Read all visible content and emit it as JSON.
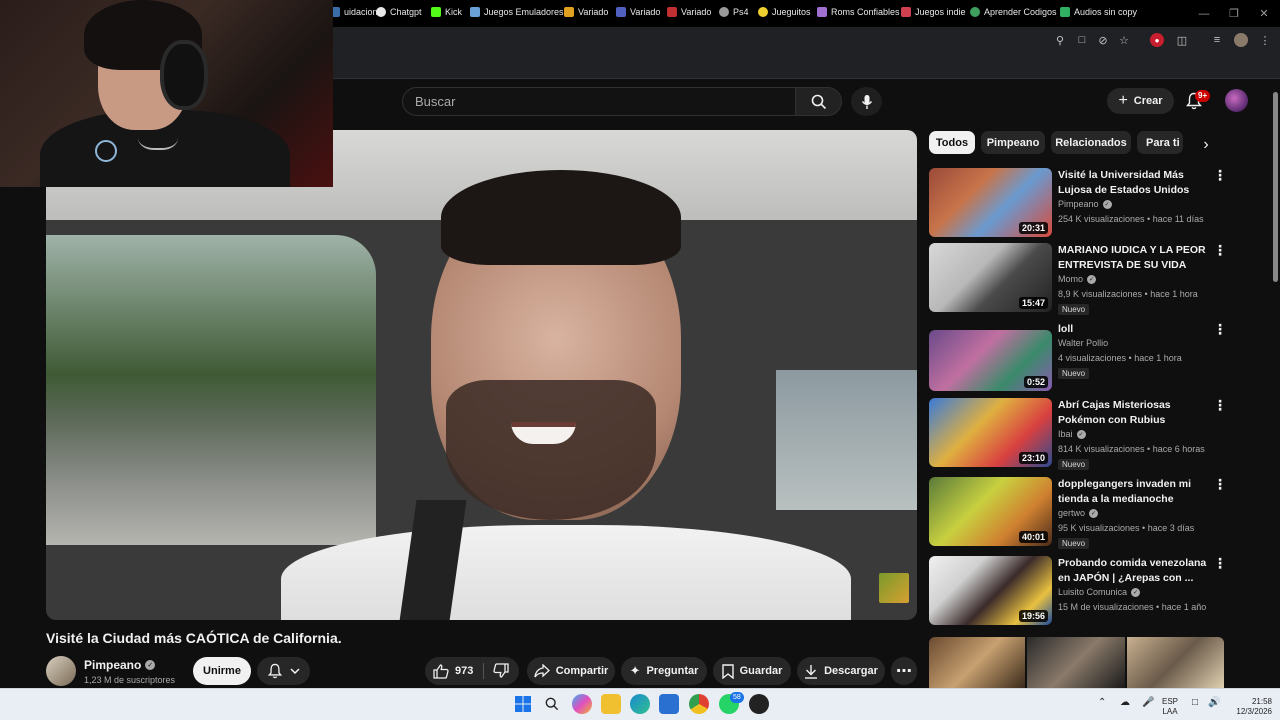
{
  "browser": {
    "window_controls": [
      "—",
      "❐",
      "✕"
    ],
    "bookmarks": [
      {
        "label": "uidacion",
        "color": "#3b6ea8"
      },
      {
        "label": "Chatgpt",
        "color": "#e8e8e8"
      },
      {
        "label": "Kick",
        "color": "#53fc18"
      },
      {
        "label": "Juegos Emuladores",
        "color": "#6aa0d8"
      },
      {
        "label": "Variado",
        "color": "#e0a020"
      },
      {
        "label": "Variado",
        "color": "#5060c0"
      },
      {
        "label": "Variado",
        "color": "#c03030"
      },
      {
        "label": "Ps4",
        "color": "#9a9a9a"
      },
      {
        "label": "Jueguitos",
        "color": "#f0d030"
      },
      {
        "label": "Roms Confiables",
        "color": "#a070d0"
      },
      {
        "label": "Juegos indie",
        "color": "#d04050"
      },
      {
        "label": "Aprender Codigos",
        "color": "#40a060"
      },
      {
        "label": "Audios sin copy",
        "color": "#30b060"
      }
    ]
  },
  "header": {
    "search_placeholder": "Buscar",
    "create_label": "Crear",
    "notification_count": "9+"
  },
  "video": {
    "title": "Visité la Ciudad más CAÓTICA de California.",
    "channel": "Pimpeano",
    "subscribers": "1,23 M de suscriptores",
    "join_label": "Unirme",
    "likes": "973",
    "share_label": "Compartir",
    "ask_label": "Preguntar",
    "save_label": "Guardar",
    "download_label": "Descargar"
  },
  "sidebar": {
    "chips": [
      "Todos",
      "Pimpeano",
      "Relacionados",
      "Para ti"
    ],
    "active_chip": "Todos",
    "recommendations": [
      {
        "title_line1": "Visité la Universidad Más",
        "title_line2": "Lujosa de Estados Unidos",
        "channel": "Pimpeano",
        "verified": true,
        "meta": "254 K visualizaciones • hace 11 días",
        "badge": "",
        "duration": "20:31",
        "thumb": "linear-gradient(135deg,#9a4a3a 0%,#c8744a 35%,#6a9ad0 60%,#d84a3a 100%)"
      },
      {
        "title_line1": "MARIANO IUDICA Y LA PEOR",
        "title_line2": "ENTREVISTA DE SU VIDA",
        "channel": "Momo",
        "verified": true,
        "meta": "8,9 K visualizaciones • hace 1 hora",
        "badge": "Nuevo",
        "duration": "15:47",
        "thumb": "linear-gradient(135deg,#d8d8d8 0%,#b8b8b8 40%,#4a4a4a 60%,#222 100%)"
      },
      {
        "title_line1": "loll",
        "title_line2": "",
        "channel": "Walter Pollio",
        "verified": false,
        "meta": "4 visualizaciones • hace 1 hora",
        "badge": "Nuevo",
        "duration": "0:52",
        "thumb": "linear-gradient(135deg,#6a4a8a 0%,#c070a0 40%,#3a8a6a 70%,#8a5ab0 100%)"
      },
      {
        "title_line1": "Abrí Cajas Misteriosas",
        "title_line2": "Pokémon con Rubius",
        "channel": "Ibai",
        "verified": true,
        "meta": "814 K visualizaciones • hace 6 horas",
        "badge": "Nuevo",
        "duration": "23:10",
        "thumb": "linear-gradient(135deg,#3a7ad8 0%,#e0b040 40%,#d84040 70%,#2a4a90 100%)"
      },
      {
        "title_line1": "dopplegangers invaden mi",
        "title_line2": "tienda a la medianoche",
        "channel": "gertwo",
        "verified": true,
        "meta": "95 K visualizaciones • hace 3 días",
        "badge": "Nuevo",
        "duration": "40:01",
        "thumb": "linear-gradient(135deg,#5a7a3a 0%,#c8d040 40%,#d08030 70%,#4a2a1a 100%)"
      },
      {
        "title_line1": "Probando comida venezolana",
        "title_line2": "en JAPÓN | ¿Arepas con ...",
        "channel": "Luisito Comunica",
        "verified": true,
        "meta": "15 M de visualizaciones • hace 1 año",
        "badge": "",
        "duration": "19:56",
        "thumb": "linear-gradient(135deg,#f0f0f0 0%,#d0d0d0 30%,#3a2a2a 55%,#e8c040 80%,#1a4aa0 100%)"
      }
    ]
  },
  "taskbar": {
    "whatsapp_badge": "58",
    "lang": "ESP",
    "lang2": "LAA",
    "time": "21:58",
    "date": "12/3/2026"
  }
}
